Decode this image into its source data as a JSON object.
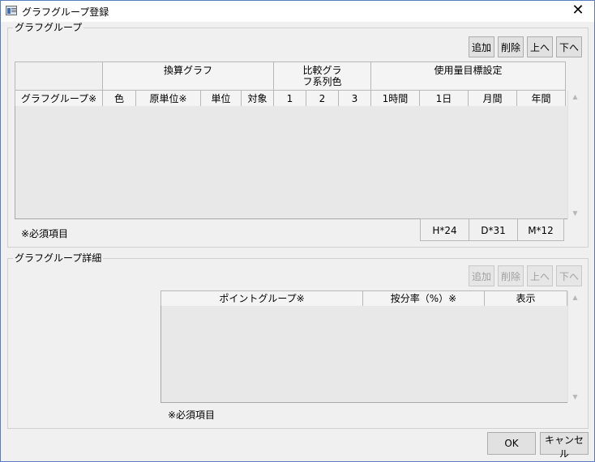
{
  "window": {
    "title": "グラフグループ登録",
    "close_glyph": "✕"
  },
  "group1": {
    "label": "グラフグループ",
    "buttons": {
      "add": "追加",
      "delete": "削除",
      "up": "上へ",
      "down": "下へ"
    },
    "grid": {
      "band_headers": [
        "換算グラフ",
        "比較グラフ系列色",
        "使用量目標設定"
      ],
      "columns": [
        "グラフグループ※",
        "色",
        "原単位※",
        "単位",
        "対象",
        "1",
        "2",
        "3",
        "1時間",
        "1日",
        "月間",
        "年間"
      ],
      "rows": []
    },
    "footer_stats": [
      "H*24",
      "D*31",
      "M*12"
    ],
    "required_note": "※必須項目"
  },
  "group2": {
    "label": "グラフグループ詳細",
    "buttons": {
      "add": "追加",
      "delete": "削除",
      "up": "上へ",
      "down": "下へ"
    },
    "grid": {
      "columns": [
        "ポイントグループ※",
        "按分率（%）※",
        "表示"
      ],
      "rows": []
    },
    "required_note": "※必須項目"
  },
  "footer": {
    "ok": "OK",
    "cancel": "キャンセル"
  },
  "scroll_arrows": {
    "up": "▲",
    "down": "▼"
  }
}
